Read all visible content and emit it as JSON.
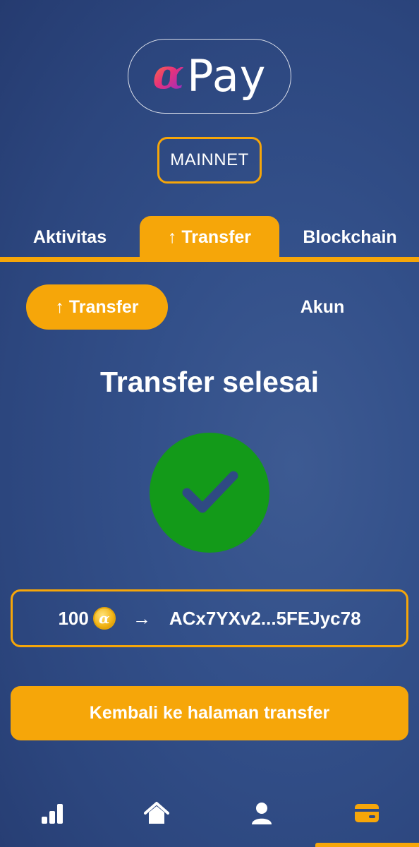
{
  "header": {
    "logo_alpha": "α",
    "logo_text": "Pay",
    "network_badge": "MAINNET"
  },
  "tabs": [
    {
      "label": "Aktivitas",
      "active": false
    },
    {
      "label": "↑ Transfer",
      "active": true
    },
    {
      "label": "Blockchain",
      "active": false
    }
  ],
  "subtabs": [
    {
      "label": "↑ Transfer",
      "active": true
    },
    {
      "label": "Akun",
      "active": false
    }
  ],
  "main": {
    "title": "Transfer selesai",
    "status_icon": "check-icon",
    "summary": {
      "amount": "100",
      "coin_symbol": "α",
      "arrow": "→",
      "recipient": "ACx7YXv2...5FEJyc78"
    },
    "back_button": "Kembali ke halaman transfer"
  },
  "bottom_nav": [
    {
      "icon": "bar-chart-icon",
      "active": false
    },
    {
      "icon": "home-icon",
      "active": false
    },
    {
      "icon": "user-icon",
      "active": false
    },
    {
      "icon": "wallet-card-icon",
      "active": true
    }
  ],
  "colors": {
    "accent": "#f6a609",
    "success": "#139a19",
    "background": "#2f4a83"
  }
}
